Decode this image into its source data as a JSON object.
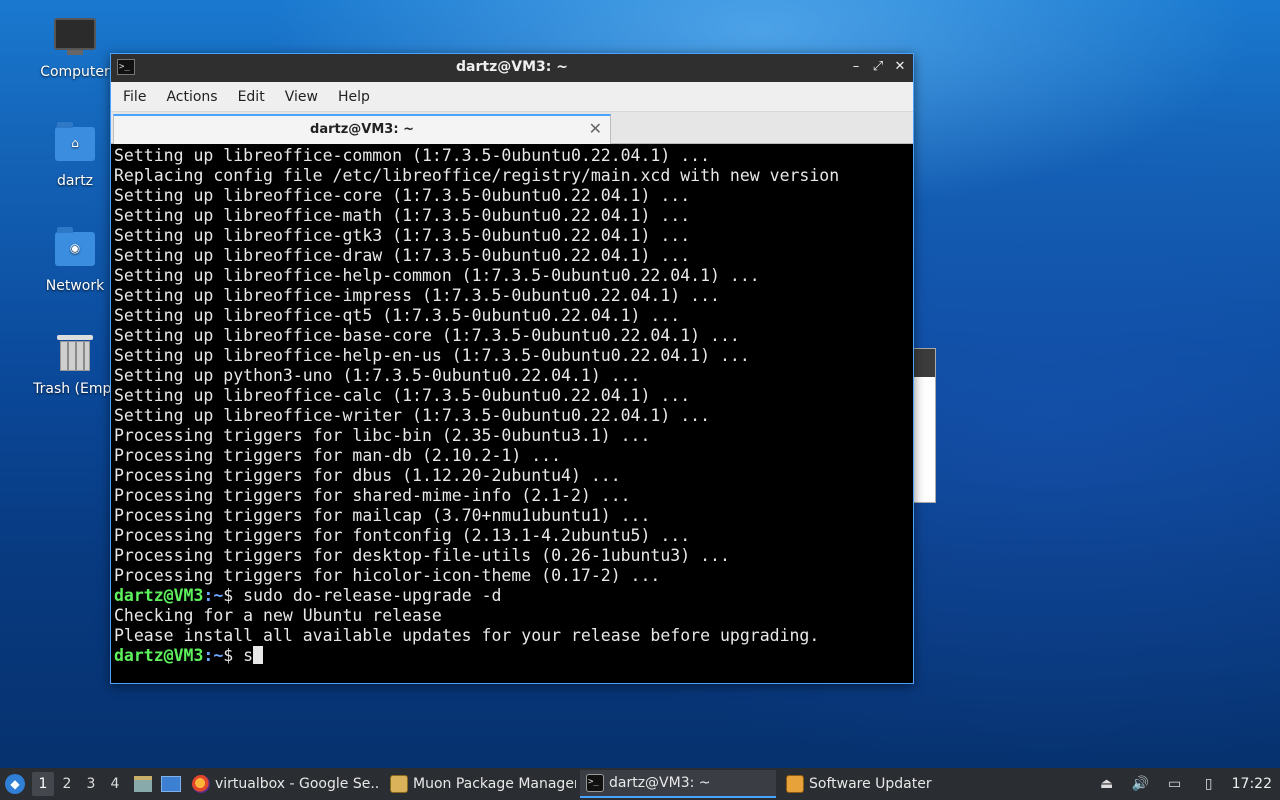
{
  "desktop": {
    "icons": [
      {
        "label": "Computer"
      },
      {
        "label": "dartz"
      },
      {
        "label": "Network"
      },
      {
        "label": "Trash (Empt"
      }
    ]
  },
  "window": {
    "title": "dartz@VM3: ~",
    "controls": {
      "minimize": "–",
      "maximize": "⤢",
      "close": "✕"
    },
    "menu": [
      "File",
      "Actions",
      "Edit",
      "View",
      "Help"
    ],
    "tab": {
      "label": "dartz@VM3: ~",
      "close": "✕"
    }
  },
  "terminal": {
    "lines": [
      "Setting up libreoffice-common (1:7.3.5-0ubuntu0.22.04.1) ...",
      "Replacing config file /etc/libreoffice/registry/main.xcd with new version",
      "Setting up libreoffice-core (1:7.3.5-0ubuntu0.22.04.1) ...",
      "Setting up libreoffice-math (1:7.3.5-0ubuntu0.22.04.1) ...",
      "Setting up libreoffice-gtk3 (1:7.3.5-0ubuntu0.22.04.1) ...",
      "Setting up libreoffice-draw (1:7.3.5-0ubuntu0.22.04.1) ...",
      "Setting up libreoffice-help-common (1:7.3.5-0ubuntu0.22.04.1) ...",
      "Setting up libreoffice-impress (1:7.3.5-0ubuntu0.22.04.1) ...",
      "Setting up libreoffice-qt5 (1:7.3.5-0ubuntu0.22.04.1) ...",
      "Setting up libreoffice-base-core (1:7.3.5-0ubuntu0.22.04.1) ...",
      "Setting up libreoffice-help-en-us (1:7.3.5-0ubuntu0.22.04.1) ...",
      "Setting up python3-uno (1:7.3.5-0ubuntu0.22.04.1) ...",
      "Setting up libreoffice-calc (1:7.3.5-0ubuntu0.22.04.1) ...",
      "Setting up libreoffice-writer (1:7.3.5-0ubuntu0.22.04.1) ...",
      "Processing triggers for libc-bin (2.35-0ubuntu3.1) ...",
      "Processing triggers for man-db (2.10.2-1) ...",
      "Processing triggers for dbus (1.12.20-2ubuntu4) ...",
      "Processing triggers for shared-mime-info (2.1-2) ...",
      "Processing triggers for mailcap (3.70+nmu1ubuntu1) ...",
      "Processing triggers for fontconfig (2.13.1-4.2ubuntu5) ...",
      "Processing triggers for desktop-file-utils (0.26-1ubuntu3) ...",
      "Processing triggers for hicolor-icon-theme (0.17-2) ..."
    ],
    "prompt_user": "dartz@VM3",
    "prompt_path": ":~",
    "prompt_symbol": "$ ",
    "command": "sudo do-release-upgrade -d",
    "output": [
      "Checking for a new Ubuntu release",
      "Please install all available updates for your release before upgrading."
    ],
    "current_input": "s"
  },
  "taskbar": {
    "workspaces": [
      "1",
      "2",
      "3",
      "4"
    ],
    "tasks": [
      {
        "label": "virtualbox - Google Se..."
      },
      {
        "label": "Muon Package Manager"
      },
      {
        "label": "dartz@VM3: ~"
      },
      {
        "label": "Software Updater"
      }
    ],
    "clock": "17:22"
  }
}
